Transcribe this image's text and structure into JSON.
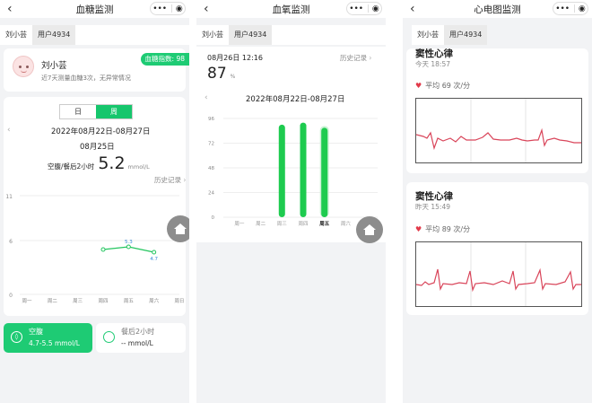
{
  "panels": [
    {
      "nav_title": "血糖监测",
      "tabs": [
        "刘小芸",
        "用户4934"
      ],
      "profile": {
        "name": "刘小芸",
        "summary": "近7天测量血糖3次，无异常情况",
        "badge": "血糖指数: 98"
      },
      "segment": {
        "day": "日",
        "week": "周"
      },
      "date_range": "2022年08月22日-08月27日",
      "selected_date": "08月25日",
      "reading": {
        "label": "空腹/餐后2小时",
        "value": "5.2",
        "unit": "mmol/L"
      },
      "history_link": "历史记录",
      "chart_data": {
        "type": "line",
        "categories": [
          "周一",
          "周二",
          "周三",
          "周四",
          "周五",
          "周六",
          "周日"
        ],
        "y_ticks": [
          "11",
          "6",
          "0"
        ],
        "ylim": [
          0,
          11
        ],
        "series": [
          {
            "values": [
              null,
              null,
              null,
              5.0,
              5.3,
              4.7,
              null
            ]
          }
        ],
        "data_labels": [
          "5.3",
          "4.7"
        ],
        "color": "#22c55e"
      },
      "cards": [
        {
          "title": "空腹",
          "value": "4.7-5.5 mmol/L"
        },
        {
          "title": "餐后2小时",
          "value": "-- mmol/L"
        }
      ]
    },
    {
      "nav_title": "血氧监测",
      "tabs": [
        "刘小芸",
        "用户4934"
      ],
      "reading_time": "08月26日 12:16",
      "history_link": "历史记录",
      "reading_value": "87",
      "reading_unit": "%",
      "date_range": "2022年08月22日-08月27日",
      "chart_data": {
        "type": "bar",
        "categories": [
          "周一",
          "周二",
          "周三",
          "周四",
          "周五",
          "周六",
          "周日"
        ],
        "values": [
          0,
          0,
          90,
          92,
          87,
          0,
          0
        ],
        "selected": "周五",
        "y_ticks": [
          "96",
          "72",
          "48",
          "24",
          "0"
        ],
        "ylim": [
          0,
          96
        ],
        "color": "#1ecb4f"
      }
    },
    {
      "nav_title": "心电图监测",
      "tabs": [
        "刘小芸",
        "用户4934"
      ],
      "records": [
        {
          "title": "窦性心律",
          "time": "今天 18:57",
          "avg": "平均 69 次/分"
        },
        {
          "title": "窦性心律",
          "time": "昨天 15:49",
          "avg": "平均 89 次/分"
        }
      ]
    }
  ],
  "icons": {
    "back": "back-arrow-icon",
    "more": "more-icon",
    "target": "target-icon",
    "home": "home-icon",
    "heart": "heart-icon",
    "chevron": "chevron-icon"
  }
}
